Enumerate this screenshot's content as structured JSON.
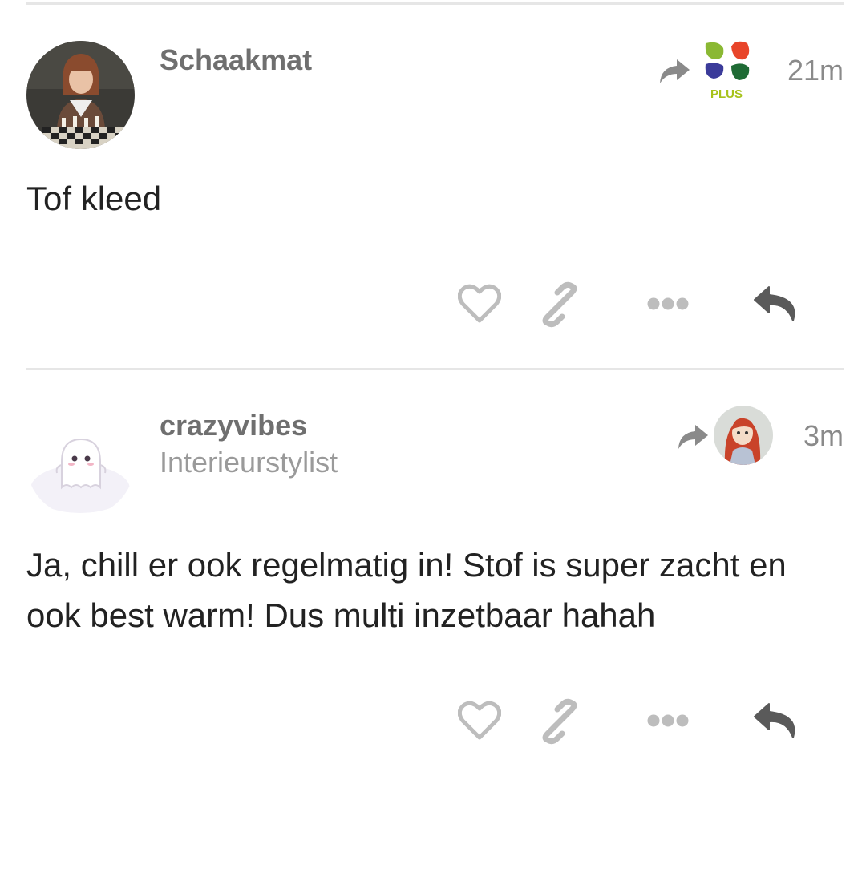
{
  "comments": [
    {
      "username": "Schaakmat",
      "subtitle": "",
      "time": "21m",
      "text": "Tof kleed",
      "avatar_icon": "chess-player-avatar",
      "repost_icon": "plus-logo-avatar",
      "plus_logo_text": "PLUS"
    },
    {
      "username": "crazyvibes",
      "subtitle": "Interieurstylist",
      "time": "3m",
      "text": "Ja, chill er ook regelmatig in! Stof is super zacht en ook best warm! Dus multi inzetbaar hahah",
      "avatar_icon": "ghost-avatar",
      "repost_icon": "red-haired-girl-avatar"
    }
  ],
  "actions": [
    "heart-icon",
    "link-icon",
    "more-icon",
    "reply-icon"
  ],
  "colors": {
    "username": "#6f6f6f",
    "subtitle": "#9a9a9a",
    "time": "#8a8a8a",
    "text": "#222222",
    "icon_light": "#bdbdbd",
    "icon_dark": "#5a5a5a",
    "divider": "#e6e6e6"
  }
}
